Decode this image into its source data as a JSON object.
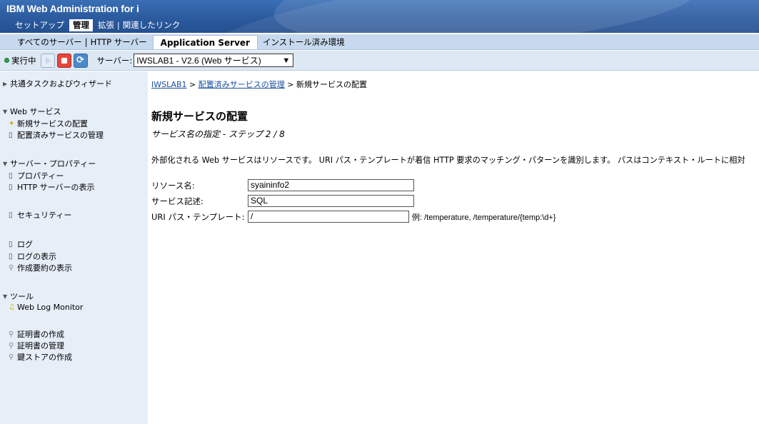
{
  "app": {
    "title": "IBM Web Administration for i"
  },
  "topnav": {
    "setup": "セットアップ",
    "manage": "管理",
    "extend": "拡張",
    "related": "関連したリンク"
  },
  "subnav": {
    "all_servers": "すべてのサーバー",
    "http_server": "HTTP サーバー",
    "app_server": "Application Server",
    "installed": "インストール済み環境"
  },
  "toolbar": {
    "status": "実行中",
    "server_label": "サーバー:",
    "server_value": "IWSLAB1 - V2.6 (Web サービス)"
  },
  "sidebar": {
    "common": "共通タスクおよびウィザード",
    "web_services": {
      "head": "Web サービス",
      "items": [
        "新規サービスの配置",
        "配置済みサービスの管理"
      ]
    },
    "server_props": {
      "head": "サーバー・プロパティー",
      "items": [
        "プロパティー",
        "HTTP サーバーの表示"
      ]
    },
    "security": "セキュリティー",
    "logs": {
      "items": [
        "ログ",
        "ログの表示",
        "作成要約の表示"
      ]
    },
    "tools": {
      "head": "ツール",
      "items": [
        "Web Log Monitor"
      ]
    },
    "certs": {
      "items": [
        "証明書の作成",
        "証明書の管理",
        "鍵ストアの作成"
      ]
    }
  },
  "main": {
    "breadcrumb": {
      "root": "IWSLAB1",
      "sep": " > ",
      "manage": "配置済みサービスの管理",
      "current": "新規サービスの配置"
    },
    "title": "新規サービスの配置",
    "subtitle": "サービス名の指定 - ステップ 2 / 8",
    "description": "外部化される Web サービスはリソースです。 URI パス・テンプレートが着信 HTTP 要求のマッチング・パターンを識別します。 パスはコンテキスト・ルートに相対",
    "form": {
      "resource_label": "リソース名:",
      "resource_value": "syaininfo2",
      "desc_label": "サービス記述:",
      "desc_value": "SQL",
      "uri_label": "URI パス・テンプレート:",
      "uri_value": "/",
      "example": "例: /temperature, /temperature/{temp:\\d+}"
    }
  }
}
